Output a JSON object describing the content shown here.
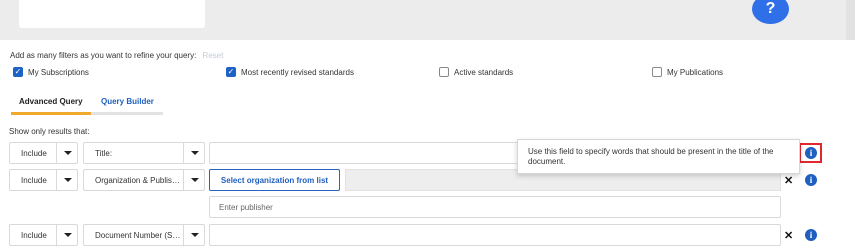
{
  "help": {
    "icon_glyph": "?"
  },
  "filters": {
    "intro": "Add as many filters as you want to refine your query:",
    "reset": "Reset",
    "checkboxes": [
      {
        "label": "My Subscriptions",
        "checked": true
      },
      {
        "label": "Most recently revised standards",
        "checked": true
      },
      {
        "label": "Active standards",
        "checked": false
      },
      {
        "label": "My Publications",
        "checked": false
      }
    ]
  },
  "tabs": [
    {
      "label": "Advanced Query",
      "active": true
    },
    {
      "label": "Query Builder",
      "active": false
    }
  ],
  "show_only_label": "Show only results that:",
  "rows": [
    {
      "include": "Include",
      "field": "Title:",
      "value": ""
    },
    {
      "include": "Include",
      "field": "Organization & Publis…",
      "button": "Select organization from list",
      "publisher_placeholder": "Enter publisher"
    },
    {
      "include": "Include",
      "field": "Document Number (S…",
      "value": ""
    }
  ],
  "tooltip": {
    "text": "Use this field to specify words that should be present in the title of the document."
  },
  "colors": {
    "accent_blue": "#1f5fbf",
    "tab_underline": "#f0a92c",
    "highlight_red": "#e0282e"
  }
}
